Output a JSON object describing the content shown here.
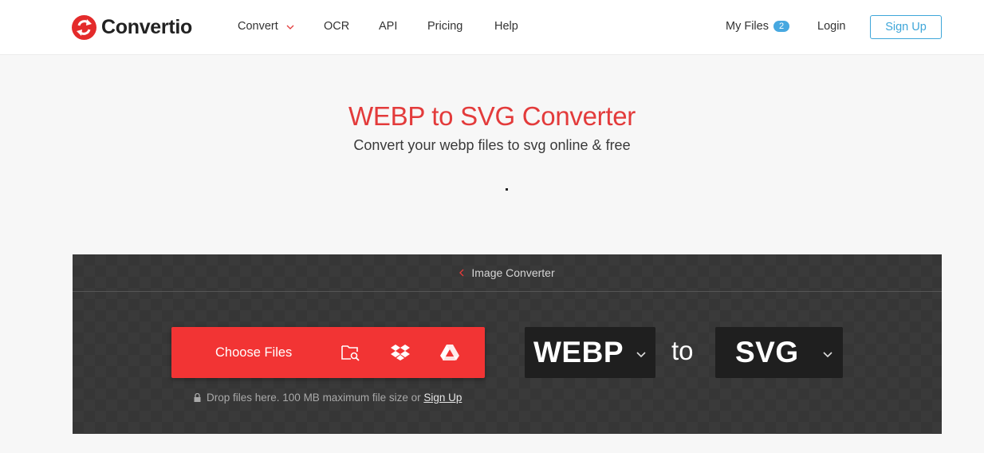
{
  "header": {
    "brand": "Convertio",
    "nav": [
      {
        "label": "Convert",
        "has_dropdown": true
      },
      {
        "label": "OCR"
      },
      {
        "label": "API"
      },
      {
        "label": "Pricing"
      },
      {
        "label": "Help"
      }
    ],
    "my_files": {
      "label": "My Files",
      "count": "2"
    },
    "login_label": "Login",
    "signup_label": "Sign Up"
  },
  "hero": {
    "title": "WEBP to SVG Converter",
    "subtitle": "Convert your webp files to svg online & free"
  },
  "converter": {
    "breadcrumb": "Image Converter",
    "choose_label": "Choose Files",
    "sources": [
      "folder-search-icon",
      "dropbox-icon",
      "google-drive-icon"
    ],
    "drop_note": "Drop files here. 100 MB maximum file size or",
    "drop_signup": "Sign Up",
    "from_format": "WEBP",
    "to_word": "to",
    "to_format": "SVG"
  },
  "colors": {
    "brand_red": "#e33b3b",
    "button_red": "#f23434",
    "accent_blue": "#3ea6d9",
    "panel_bg": "#3a3a3a",
    "format_bg": "#1f1f1f"
  }
}
